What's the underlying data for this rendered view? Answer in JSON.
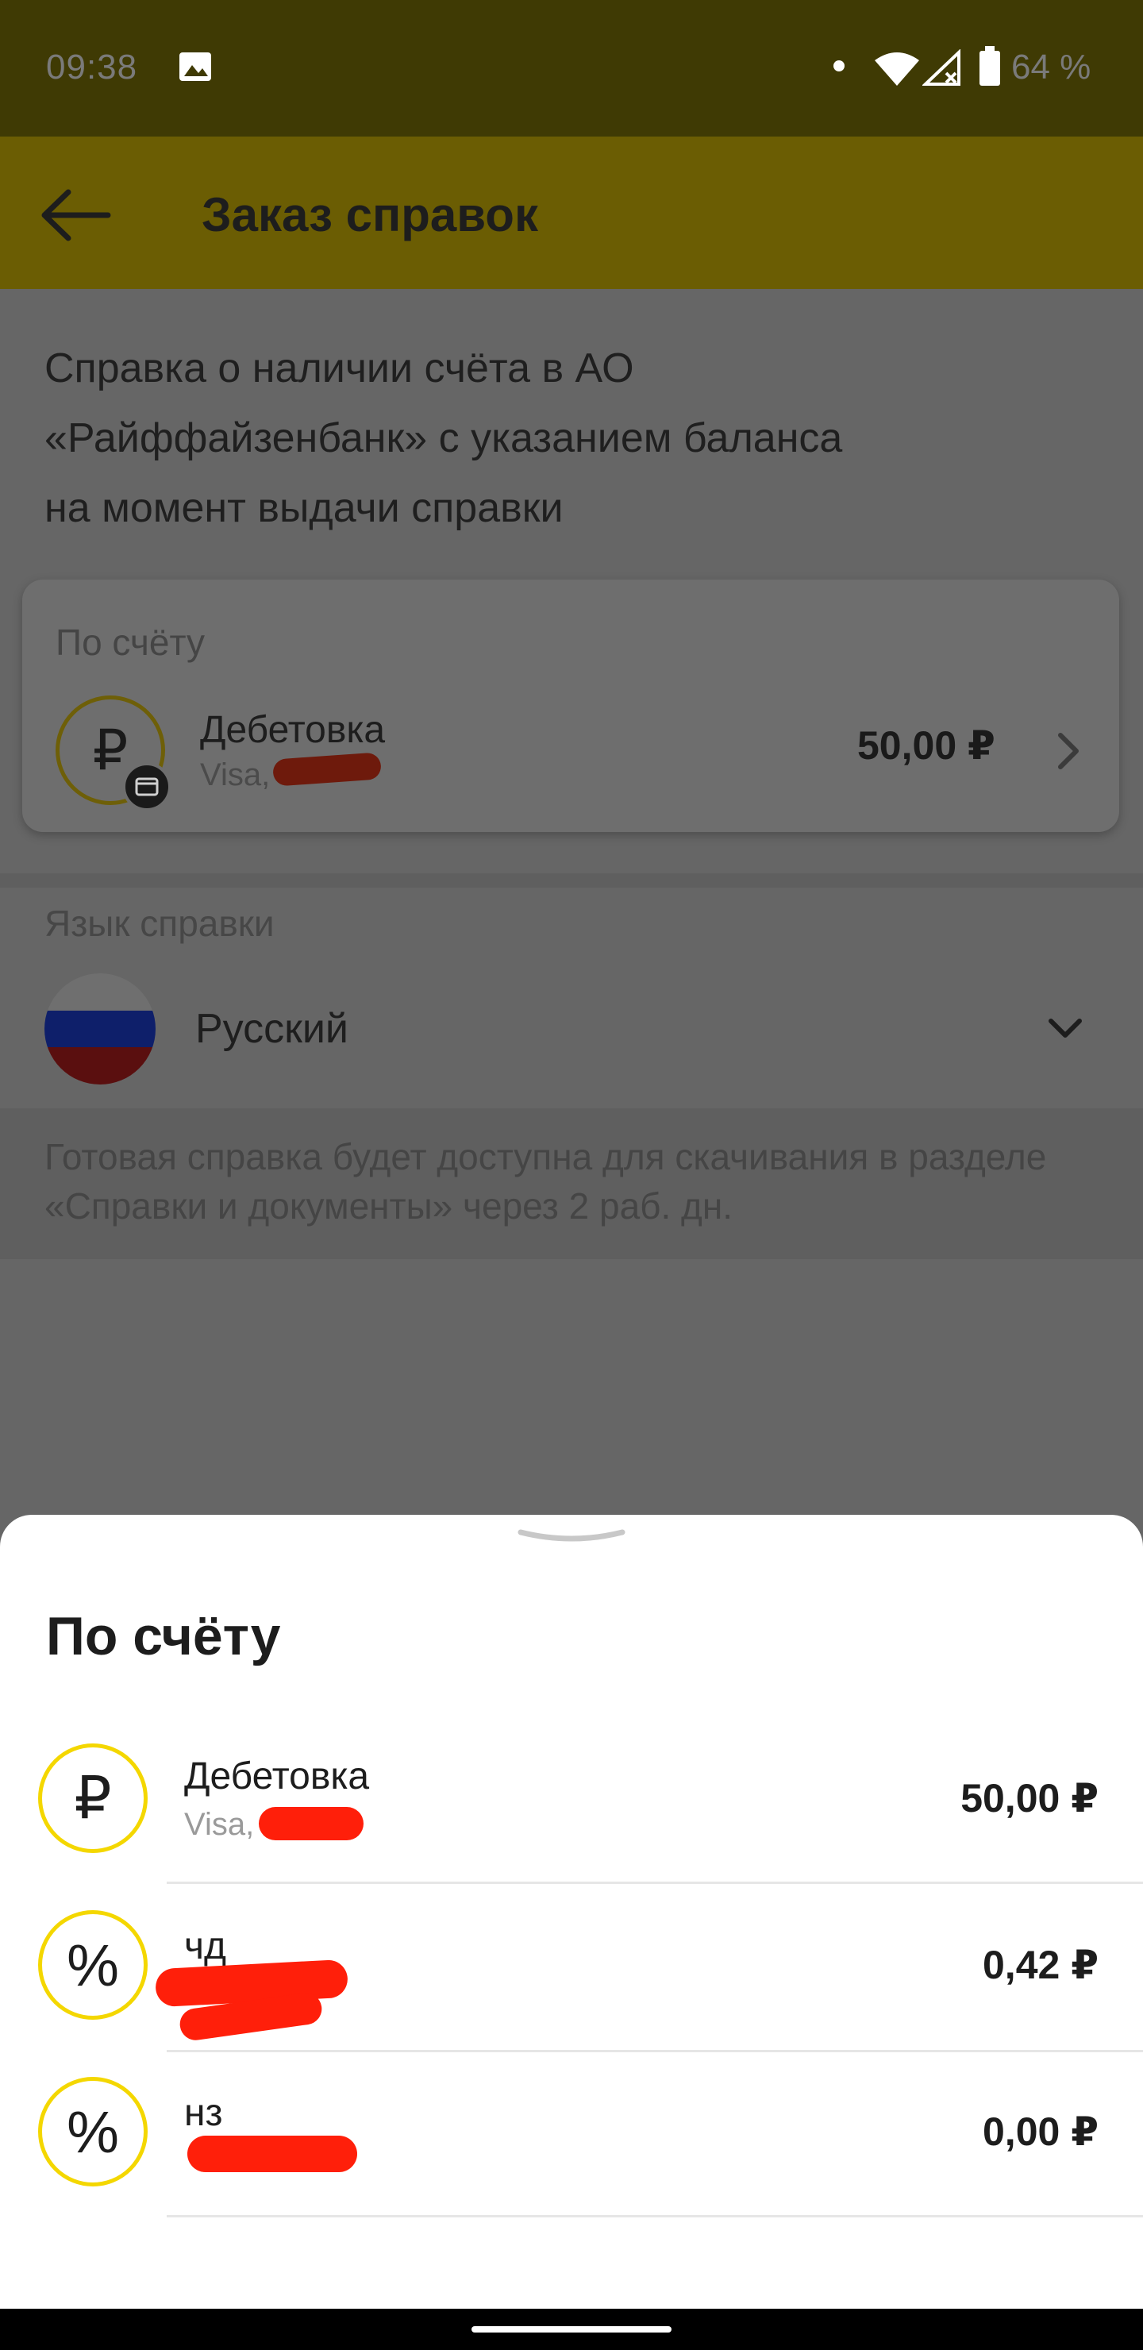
{
  "status_bar": {
    "time": "09:38",
    "battery": "64 %"
  },
  "app_bar": {
    "title": "Заказ справок"
  },
  "description": "Справка о наличии счёта в АО\n«Райффайзенбанк» с указанием баланса\nна момент выдачи справки",
  "account_card": {
    "label": "По счёту",
    "name": "Дебетовка",
    "sub": "Visa,",
    "amount": "50,00 ₽"
  },
  "language": {
    "label": "Язык справки",
    "value": "Русский"
  },
  "note": "Готовая справка будет доступна для скачивания в разделе «Справки и документы» через 2 раб. дн.",
  "sheet": {
    "title": "По счёту",
    "rows": [
      {
        "icon": "₽",
        "name": "Дебетовка",
        "sub": "Visa,",
        "amount": "50,00 ₽"
      },
      {
        "icon": "%",
        "name": "чд",
        "sub": "",
        "amount": "0,42 ₽"
      },
      {
        "icon": "%",
        "name": "нз",
        "sub": "",
        "amount": "0,00 ₽"
      }
    ]
  },
  "colors": {
    "brand_yellow": "#f4d700",
    "redaction": "#ff1f0a"
  }
}
